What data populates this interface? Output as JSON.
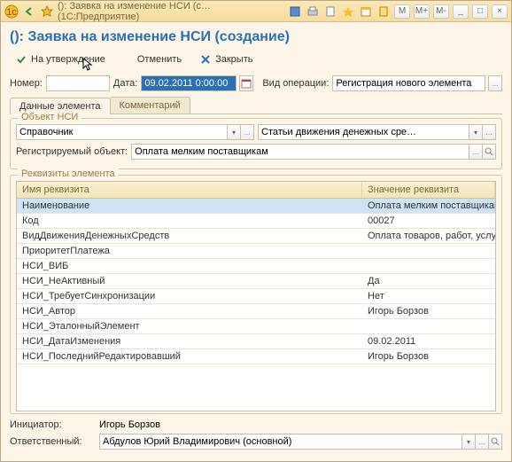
{
  "titlebar": {
    "title": "(): Заявка на изменение НСИ (с…   (1С:Предприятие)",
    "mem": [
      "M",
      "M+",
      "M-"
    ]
  },
  "page_title": "(): Заявка на изменение НСИ (создание)",
  "toolbar": {
    "approve": "На утверждение",
    "cancel": "Отменить",
    "close": "Закрыть"
  },
  "header": {
    "number_label": "Номер:",
    "number_value": "",
    "date_label": "Дата:",
    "date_value": "09.02.2011 0:00:00",
    "optype_label": "Вид операции:",
    "optype_value": "Регистрация нового элемента"
  },
  "tabs": {
    "t1": "Данные элемента",
    "t2": "Комментарий"
  },
  "fieldset1": {
    "title": "Объект НСИ",
    "ref_value": "Справочник",
    "right_value": "Статьи движения денежных сре…",
    "reg_label": "Регистрируемый объект:",
    "reg_value": "Оплата мелким поставщикам"
  },
  "fieldset2": {
    "title": "Реквизиты элемента",
    "col1": "Имя реквизита",
    "col2": "Значение реквизита",
    "rows": [
      {
        "name": "Наименование",
        "value": "Оплата мелким поставщикам"
      },
      {
        "name": "Код",
        "value": "00027"
      },
      {
        "name": "ВидДвиженияДенежныхСредств",
        "value": "Оплата товаров, работ, услуг, сырья …"
      },
      {
        "name": "ПриоритетПлатежа",
        "value": ""
      },
      {
        "name": "НСИ_ВИБ",
        "value": ""
      },
      {
        "name": "НСИ_НеАктивный",
        "value": "Да"
      },
      {
        "name": "НСИ_ТребуетСинхронизации",
        "value": "Нет"
      },
      {
        "name": "НСИ_Автор",
        "value": "Игорь Борзов"
      },
      {
        "name": "НСИ_ЭталонныйЭлемент",
        "value": ""
      },
      {
        "name": "НСИ_ДатаИзменения",
        "value": "09.02.2011"
      },
      {
        "name": "НСИ_ПоследнийРедактировавший",
        "value": "Игорь Борзов"
      }
    ]
  },
  "footer": {
    "initiator_label": "Инициатор:",
    "initiator_value": "Игорь Борзов",
    "responsible_label": "Ответственный:",
    "responsible_value": "Абдулов Юрий Владимирович (основной)"
  }
}
